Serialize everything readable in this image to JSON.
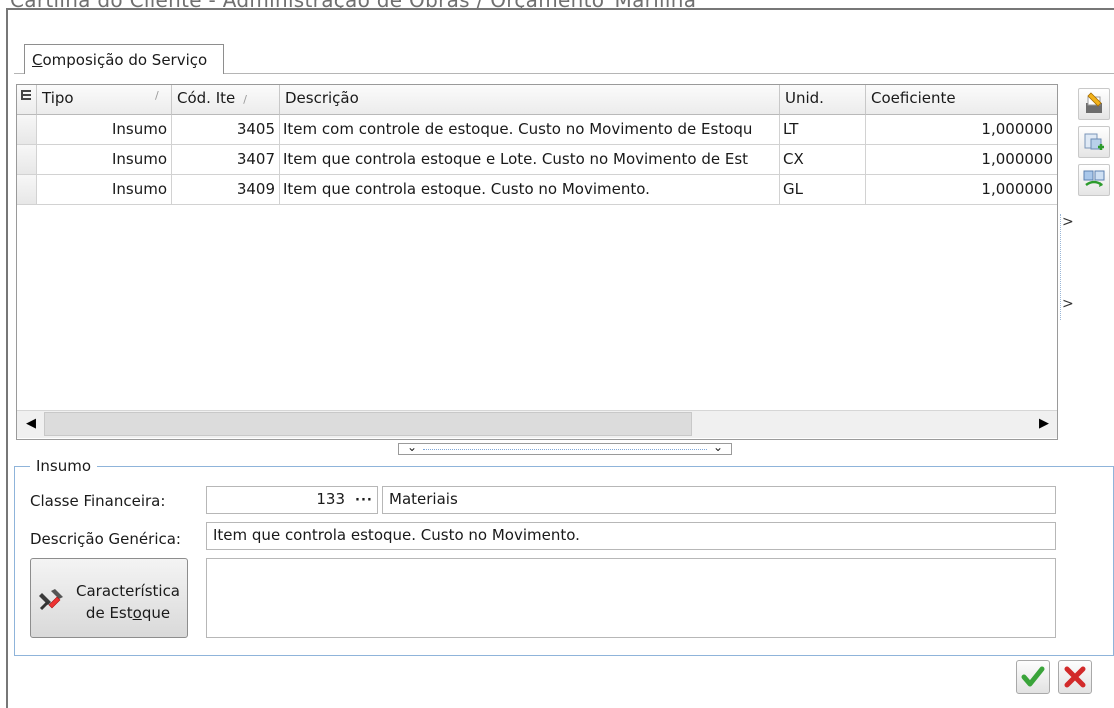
{
  "window": {
    "title": "Cartilha do Cliente - Administração de Obras / Orçamento_Marilina"
  },
  "tabs": [
    {
      "label_pre": "",
      "label_ul": "C",
      "label_post": "omposição do Serviço"
    }
  ],
  "grid": {
    "columns": {
      "tipo": "Tipo",
      "cod": "Cód. Ite",
      "descricao": "Descrição",
      "unid": "Unid.",
      "coef": "Coeficiente"
    },
    "sort_glyph": "/",
    "rows": [
      {
        "tipo": "Insumo",
        "cod": "3405",
        "descricao": "Item com controle de estoque. Custo no Movimento de Estoqu",
        "unid": "LT",
        "coef": "1,000000"
      },
      {
        "tipo": "Insumo",
        "cod": "3407",
        "descricao": "Item que controla estoque e Lote. Custo no Movimento de Est",
        "unid": "CX",
        "coef": "1,000000"
      },
      {
        "tipo": "Insumo",
        "cod": "3409",
        "descricao": "Item que controla estoque. Custo no Movimento.",
        "unid": "GL",
        "coef": "1,000000"
      }
    ]
  },
  "insumo": {
    "group_title": "Insumo",
    "classe_label": "Classe Financeira:",
    "classe_code": "133",
    "classe_name": "Materiais",
    "desc_label": "Descrição Genérica:",
    "desc_value": "Item que controla estoque. Custo no Movimento.",
    "estoque_line1": "Característica",
    "estoque_line2_pre": "de Est",
    "estoque_line2_ul": "o",
    "estoque_line2_post": "que"
  },
  "icons": {
    "toolbar": [
      "edit-item-icon",
      "add-item-icon",
      "replace-item-icon"
    ],
    "ok": "check-icon",
    "cancel": "close-icon"
  },
  "colors": {
    "group_border": "#8fb4da",
    "ok": "#3aa43a",
    "cancel": "#d22a2a"
  }
}
